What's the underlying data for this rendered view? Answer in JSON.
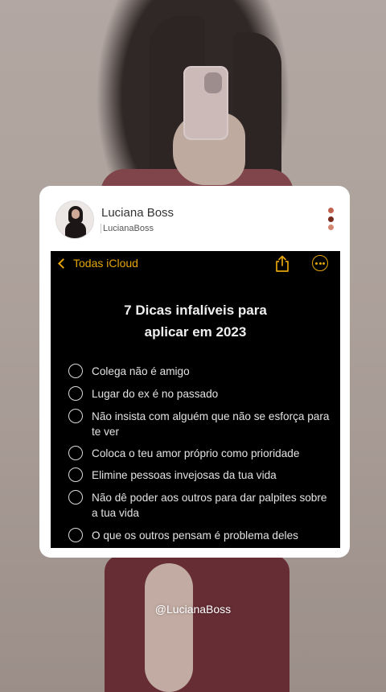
{
  "post": {
    "user_name": "Luciana Boss",
    "user_handle": "LucianaBoss",
    "menu_dot_colors": [
      "#c0634e",
      "#7a2b20",
      "#d2866f"
    ]
  },
  "notes": {
    "back_label": "Todas iCloud",
    "title_line1": "7 Dicas infalíveis para",
    "title_line2": "aplicar em  2023",
    "accent_color": "#e5a50a",
    "items": [
      "Colega não é amigo",
      "Lugar do ex é no passado",
      "Não insista com alguém que não se esforça para te ver",
      "Coloca o teu amor próprio como prioridade",
      "Elimine pessoas invejosas da tua vida",
      "Não dê poder aos outros para dar palpites sobre a tua vida",
      "O que os outros pensam é problema deles"
    ]
  },
  "footer": {
    "handle": "@LucianaBoss"
  }
}
